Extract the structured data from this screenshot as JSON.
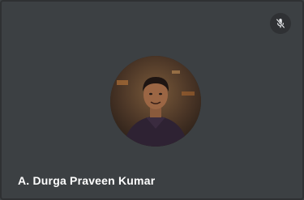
{
  "participant": {
    "name": "A. Durga Praveen Kumar",
    "mic_state_icon": "mic-off-icon",
    "avatar_icon": "participant-photo"
  },
  "colors": {
    "tile_background": "#3c4043",
    "name_text": "#ffffff",
    "mute_button_bg": "#2f3134"
  }
}
